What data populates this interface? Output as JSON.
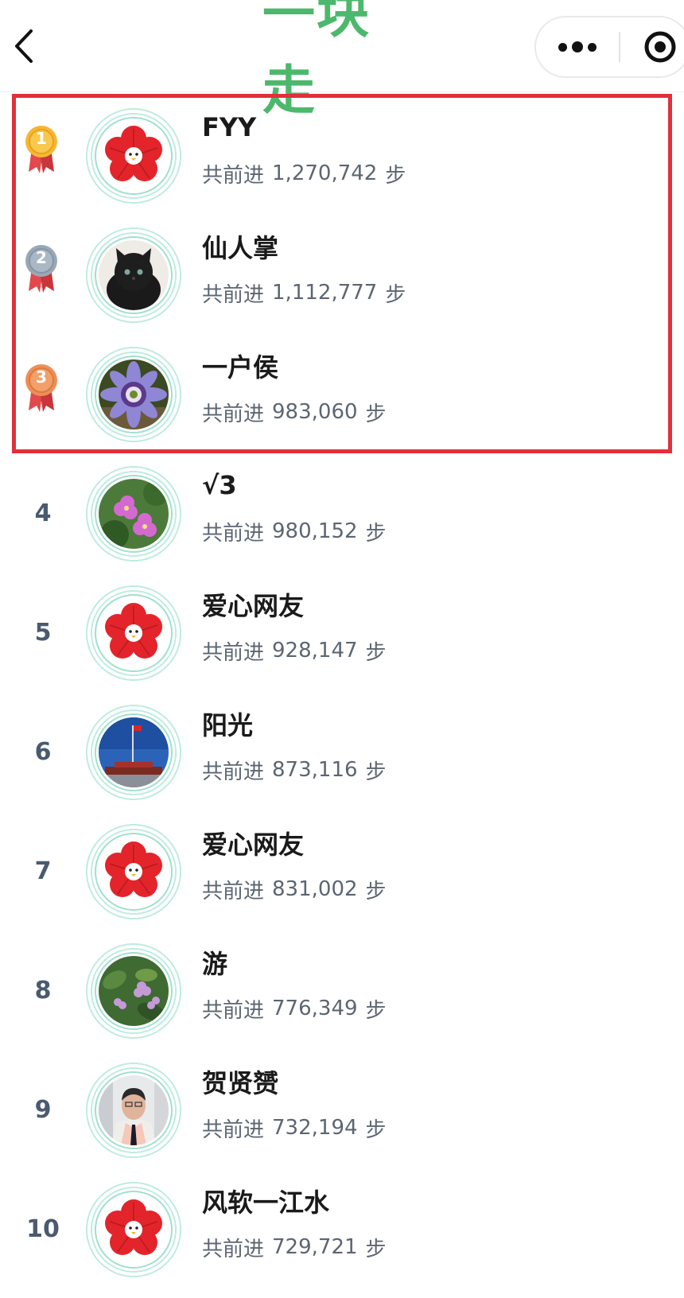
{
  "nav": {
    "title": "一块走",
    "back_icon": "chevron-left-icon",
    "more_icon": "more-dots-icon",
    "close_icon": "record-target-icon"
  },
  "colors": {
    "title_green": "#4cb86c",
    "highlight_red": "#e0303a",
    "ring_mint": "#bfece0",
    "gold": "#f5b833",
    "silver": "#9aa8b6",
    "bronze": "#ee8f55",
    "ribbon_red": "#e2494d"
  },
  "steps_prefix": "共前进",
  "steps_suffix": "步",
  "ranking": [
    {
      "rank": "1",
      "name": "FYY",
      "steps": "1,270,742",
      "medal": "gold",
      "avatar": "red-flower-avatar"
    },
    {
      "rank": "2",
      "name": "仙人掌",
      "steps": "1,112,777",
      "medal": "silver",
      "avatar": "black-kitten-photo"
    },
    {
      "rank": "3",
      "name": "一户侯",
      "steps": "983,060",
      "medal": "bronze",
      "avatar": "passion-flower-photo"
    },
    {
      "rank": "4",
      "name": "√3",
      "steps": "980,152",
      "medal": "",
      "avatar": "pink-flowers-photo"
    },
    {
      "rank": "5",
      "name": "爱心网友",
      "steps": "928,147",
      "medal": "",
      "avatar": "red-flower-avatar"
    },
    {
      "rank": "6",
      "name": "阳光",
      "steps": "873,116",
      "medal": "",
      "avatar": "tiananmen-photo"
    },
    {
      "rank": "7",
      "name": "爱心网友",
      "steps": "831,002",
      "medal": "",
      "avatar": "red-flower-avatar"
    },
    {
      "rank": "8",
      "name": "游",
      "steps": "776,349",
      "medal": "",
      "avatar": "purple-flowers-photo"
    },
    {
      "rank": "9",
      "name": "贺贤赟",
      "steps": "732,194",
      "medal": "",
      "avatar": "man-portrait-photo"
    },
    {
      "rank": "10",
      "name": "风软一江水",
      "steps": "729,721",
      "medal": "",
      "avatar": "red-flower-avatar"
    }
  ]
}
